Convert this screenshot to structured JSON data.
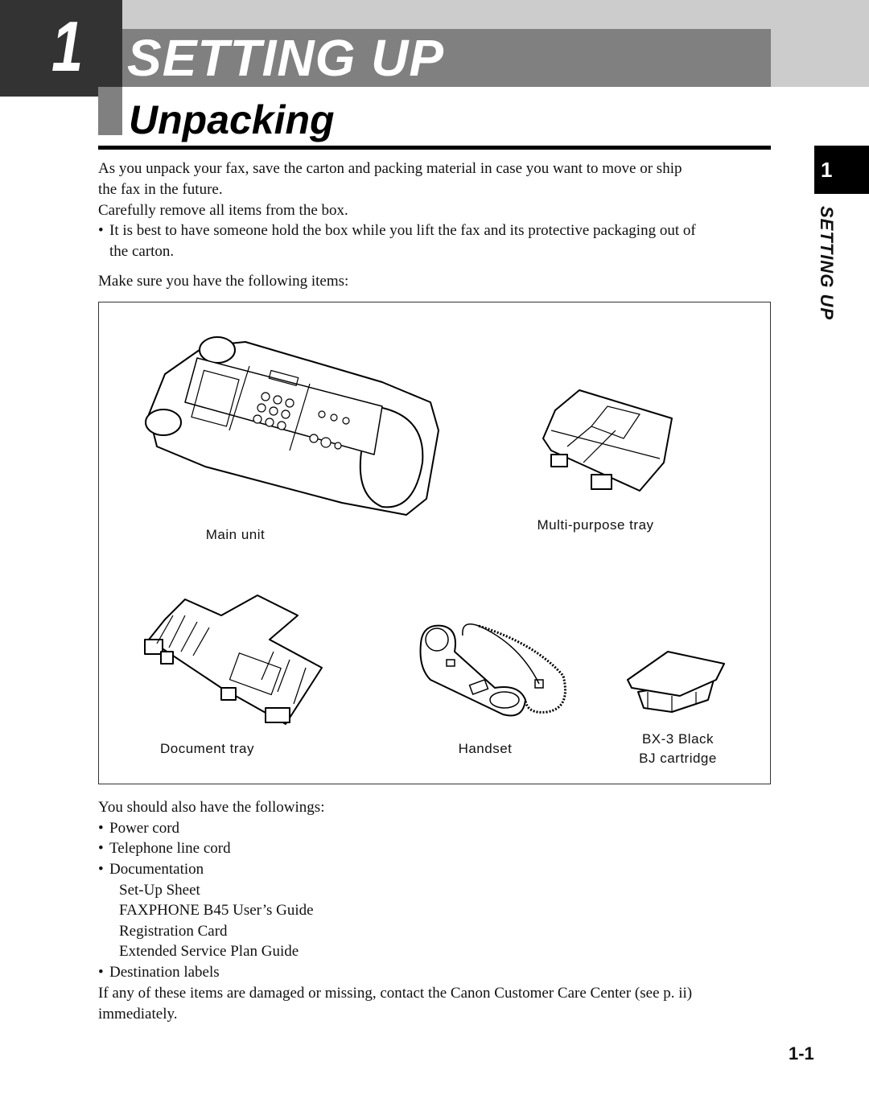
{
  "header": {
    "chapter_number": "1",
    "chapter_title": "SETTING UP",
    "section_title": "Unpacking"
  },
  "side_tab": {
    "number": "1",
    "label": "SETTING UP"
  },
  "intro": {
    "lines": [
      "As you unpack your fax, save the carton and packing material in case you want to move or ship",
      "the fax in the future.",
      "Carefully remove all items from the box."
    ],
    "bullet": {
      "line1": "It is best to have someone hold the box while you lift the fax and its protective packaging out of",
      "line2": "the carton."
    },
    "checklist_lead": "Make sure you have the following items:"
  },
  "figure": {
    "items": [
      {
        "label": "Main unit",
        "icon": "fax-main-unit-illustration"
      },
      {
        "label": "Multi-purpose tray",
        "icon": "multipurpose-tray-illustration"
      },
      {
        "label": "Document tray",
        "icon": "document-tray-illustration"
      },
      {
        "label": "Handset",
        "icon": "handset-illustration"
      },
      {
        "label_line1": "BX-3 Black",
        "label_line2": "BJ cartridge",
        "icon": "bj-cartridge-illustration"
      }
    ]
  },
  "also_have": {
    "lead": "You should also have the followings:",
    "bullets": [
      "Power cord",
      "Telephone line cord",
      "Documentation"
    ],
    "documentation": [
      "Set-Up Sheet",
      "FAXPHONE B45 User’s Guide",
      "Registration Card",
      "Extended Service Plan Guide"
    ],
    "last_bullet": "Destination labels"
  },
  "closing": {
    "line1": "If any of these items are damaged or missing, contact the Canon Customer Care Center (see p. ii)",
    "line2": "immediately."
  },
  "page_number": "1-1"
}
